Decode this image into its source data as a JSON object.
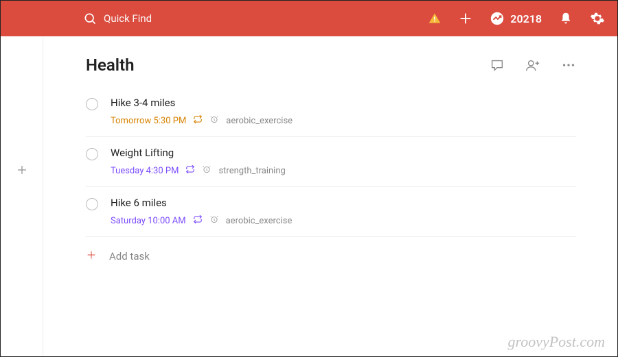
{
  "header": {
    "search_placeholder": "Quick Find",
    "karma_points": "20218"
  },
  "project": {
    "title": "Health"
  },
  "tasks": [
    {
      "title": "Hike 3-4 miles",
      "due": "Tomorrow 5:30 PM",
      "due_color": "orange",
      "label": "aerobic_exercise"
    },
    {
      "title": "Weight Lifting",
      "due": "Tuesday 4:30 PM",
      "due_color": "purple",
      "label": "strength_training"
    },
    {
      "title": "Hike 6 miles",
      "due": "Saturday 10:00 AM",
      "due_color": "purple",
      "label": "aerobic_exercise"
    }
  ],
  "add_task_label": "Add task",
  "watermark": "groovyPost.com"
}
